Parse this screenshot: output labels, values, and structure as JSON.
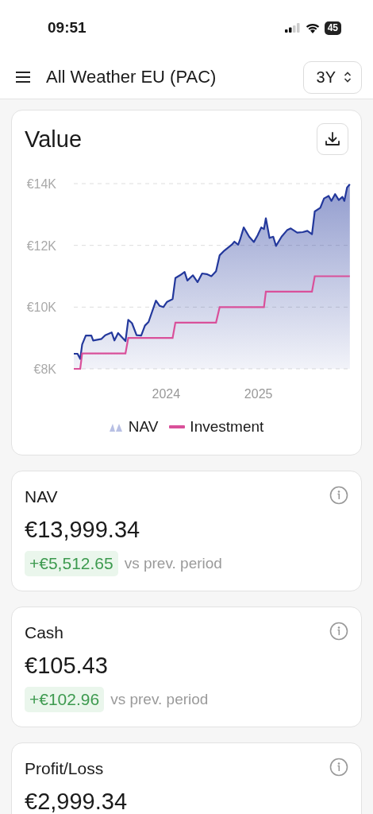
{
  "status_bar": {
    "time": "09:51",
    "battery": "45"
  },
  "header": {
    "title": "All Weather EU (PAC)",
    "period": "3Y"
  },
  "value_card": {
    "title": "Value",
    "chart_data": {
      "type": "area",
      "x": [
        2023.0,
        2023.04,
        2023.07,
        2023.09,
        2023.13,
        2023.19,
        2023.21,
        2023.3,
        2023.34,
        2023.41,
        2023.44,
        2023.48,
        2023.56,
        2023.59,
        2023.63,
        2023.68,
        2023.73,
        2023.77,
        2023.81,
        2023.89,
        2023.93,
        2023.97,
        2024.01,
        2024.07,
        2024.1,
        2024.15,
        2024.2,
        2024.23,
        2024.29,
        2024.34,
        2024.39,
        2024.44,
        2024.49,
        2024.54,
        2024.58,
        2024.63,
        2024.71,
        2024.74,
        2024.78,
        2024.8,
        2024.84,
        2024.9,
        2024.95,
        2024.99,
        2025.03,
        2025.06,
        2025.08,
        2025.12,
        2025.16,
        2025.19,
        2025.25,
        2025.31,
        2025.35,
        2025.42,
        2025.48,
        2025.53,
        2025.58,
        2025.61,
        2025.67,
        2025.71,
        2025.76,
        2025.79,
        2025.83,
        2025.87,
        2025.91,
        2025.93,
        2025.96,
        2025.99
      ],
      "series": [
        {
          "name": "NAV",
          "color": "#23389c",
          "values": [
            8490,
            8490,
            8320,
            8790,
            9080,
            9080,
            8920,
            8970,
            9090,
            9180,
            8920,
            9160,
            8900,
            9590,
            9480,
            9090,
            9080,
            9400,
            9520,
            10210,
            10040,
            10000,
            10170,
            10260,
            10940,
            11030,
            11140,
            10860,
            11030,
            10810,
            11090,
            11070,
            11000,
            11160,
            11680,
            11830,
            12020,
            12120,
            12020,
            12180,
            12580,
            12280,
            12110,
            12320,
            12580,
            12530,
            12880,
            12240,
            12280,
            11980,
            12280,
            12490,
            12550,
            12410,
            12430,
            12470,
            12360,
            13100,
            13220,
            13520,
            13600,
            13440,
            13660,
            13470,
            13570,
            13440,
            13870,
            13980
          ]
        },
        {
          "name": "Investment",
          "type": "line",
          "color": "#d9509a",
          "values": [
            8000,
            8000,
            8000,
            8500,
            8500,
            8500,
            8500,
            8500,
            8500,
            8500,
            8500,
            8500,
            8500,
            9000,
            9000,
            9000,
            9000,
            9000,
            9000,
            9000,
            9000,
            9000,
            9000,
            9000,
            9500,
            9500,
            9500,
            9500,
            9500,
            9500,
            9500,
            9500,
            9500,
            9500,
            10000,
            10000,
            10000,
            10000,
            10000,
            10000,
            10000,
            10000,
            10000,
            10000,
            10000,
            10000,
            10500,
            10500,
            10500,
            10500,
            10500,
            10500,
            10500,
            10500,
            10500,
            10500,
            10500,
            11000,
            11000,
            11000,
            11000,
            11000,
            11000,
            11000,
            11000,
            11000,
            11000,
            11000
          ]
        }
      ],
      "xlim": [
        2023,
        2026
      ],
      "ylim": [
        8000,
        14000
      ],
      "xticks": [
        {
          "value": 2024,
          "label": "2024"
        },
        {
          "value": 2025,
          "label": "2025"
        }
      ],
      "yticks": [
        {
          "value": 8000,
          "label": "€8K"
        },
        {
          "value": 10000,
          "label": "€10K"
        },
        {
          "value": 12000,
          "label": "€12K"
        },
        {
          "value": 14000,
          "label": "€14K"
        }
      ]
    }
  },
  "metrics": [
    {
      "label": "NAV",
      "value": "€13,999.34",
      "change": "+€5,512.65",
      "comparison": "vs prev. period"
    },
    {
      "label": "Cash",
      "value": "€105.43",
      "change": "+€102.96",
      "comparison": "vs prev. period"
    },
    {
      "label": "Profit/Loss",
      "value": "€2,999.34"
    }
  ]
}
